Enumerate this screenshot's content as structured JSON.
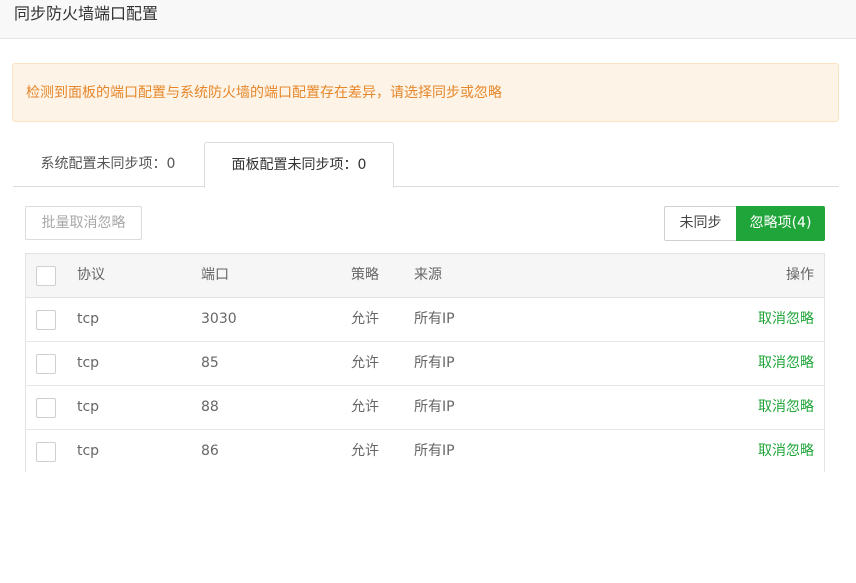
{
  "dialog": {
    "title": "同步防火墙端口配置"
  },
  "alert": {
    "text": "检测到面板的端口配置与系统防火墙的端口配置存在差异，请选择同步或忽略"
  },
  "tabs": [
    {
      "label": "系统配置未同步项：0",
      "active": false
    },
    {
      "label": "面板配置未同步项：0",
      "active": true
    }
  ],
  "toolbar": {
    "batch_cancel_label": "批量取消忽略",
    "filter_unsynced_label": "未同步",
    "filter_ignored_label": "忽略项(4)"
  },
  "table": {
    "headers": {
      "protocol": "协议",
      "port": "端口",
      "policy": "策略",
      "source": "来源",
      "action": "操作"
    },
    "rows": [
      {
        "protocol": "tcp",
        "port": "3030",
        "policy": "允许",
        "source": "所有IP",
        "action": "取消忽略"
      },
      {
        "protocol": "tcp",
        "port": "85",
        "policy": "允许",
        "source": "所有IP",
        "action": "取消忽略"
      },
      {
        "protocol": "tcp",
        "port": "88",
        "policy": "允许",
        "source": "所有IP",
        "action": "取消忽略"
      },
      {
        "protocol": "tcp",
        "port": "86",
        "policy": "允许",
        "source": "所有IP",
        "action": "取消忽略"
      }
    ]
  },
  "colors": {
    "accent_green": "#20a53a",
    "alert_text": "#e6872b",
    "alert_bg": "#fdf4e7"
  }
}
